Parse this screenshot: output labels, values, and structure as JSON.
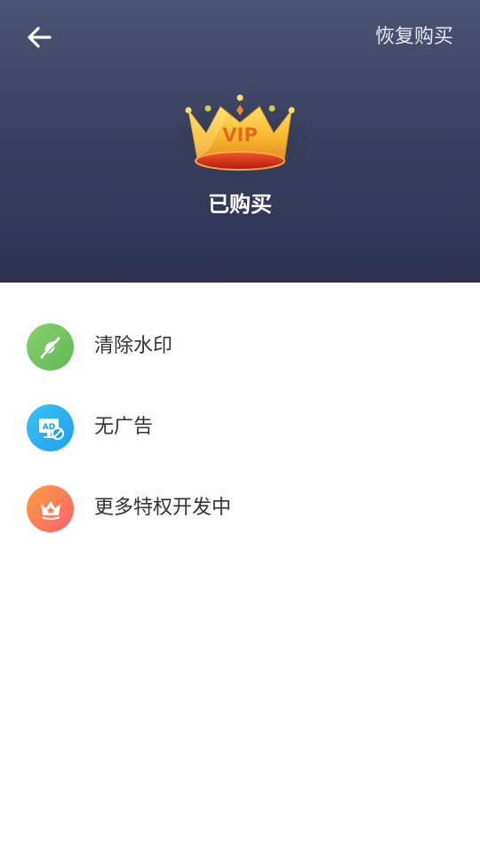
{
  "header": {
    "restore_label": "恢复购买",
    "status": "已购买",
    "crown_text": "VIP"
  },
  "benefits": [
    {
      "label": "清除水印",
      "icon": "watermark-remove-icon",
      "color_from": "#8bd06e",
      "color_to": "#5cb955"
    },
    {
      "label": "无广告",
      "icon": "no-ad-icon",
      "color_from": "#3cc3f7",
      "color_to": "#1e9ef0"
    },
    {
      "label": "更多特权开发中",
      "icon": "crown-icon",
      "color_from": "#ff9f3d",
      "color_to": "#ff5f6f"
    }
  ],
  "colors": {
    "header_top": "#4b5373",
    "header_bottom": "#2c3250",
    "text": "#333333"
  }
}
